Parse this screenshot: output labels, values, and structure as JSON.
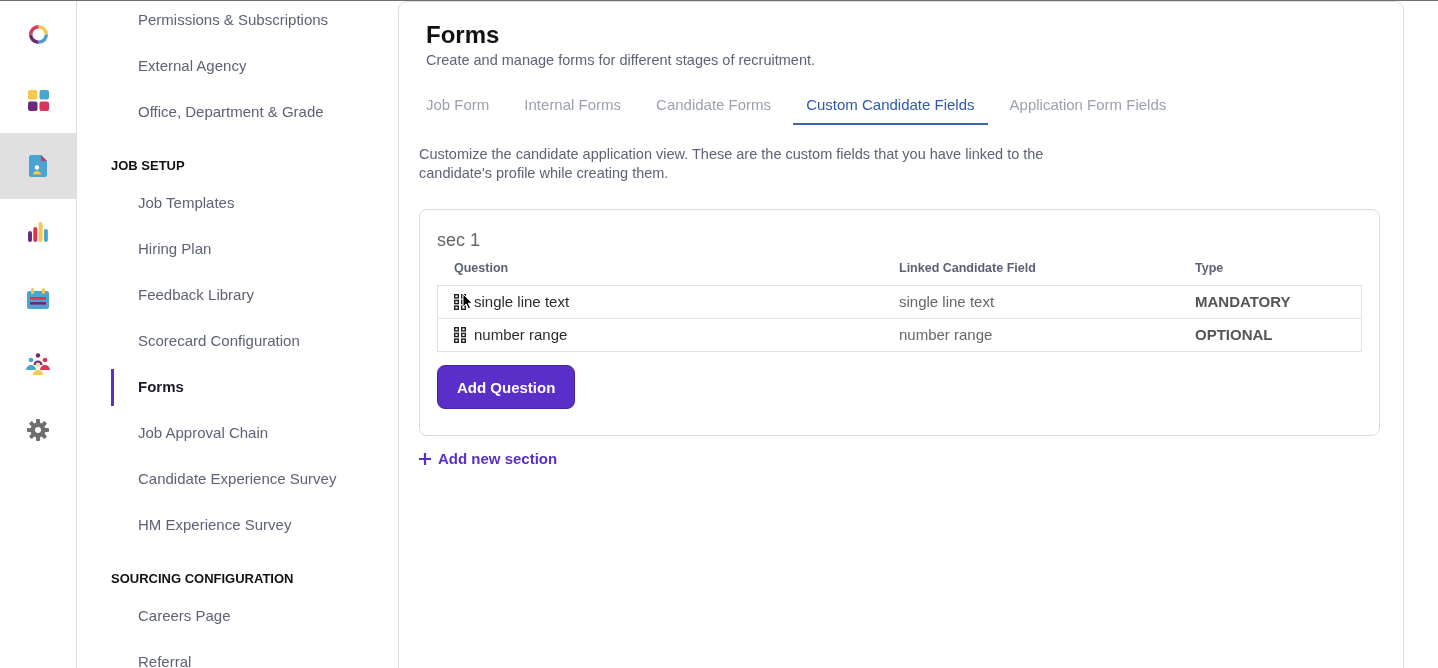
{
  "rail": {
    "items": [
      {
        "selected": false
      },
      {
        "selected": true
      },
      {
        "selected": false
      },
      {
        "selected": false
      },
      {
        "selected": false
      },
      {
        "selected": false
      }
    ]
  },
  "sidebar": {
    "sections": [
      {
        "items": [
          {
            "label": "Permissions & Subscriptions",
            "selected": false
          },
          {
            "label": "External Agency",
            "selected": false
          },
          {
            "label": "Office, Department & Grade",
            "selected": false
          }
        ]
      },
      {
        "heading": "JOB SETUP",
        "items": [
          {
            "label": "Job Templates",
            "selected": false
          },
          {
            "label": "Hiring Plan",
            "selected": false
          },
          {
            "label": "Feedback Library",
            "selected": false
          },
          {
            "label": "Scorecard Configuration",
            "selected": false
          },
          {
            "label": "Forms",
            "selected": true
          },
          {
            "label": "Job Approval Chain",
            "selected": false
          },
          {
            "label": "Candidate Experience Survey",
            "selected": false
          },
          {
            "label": "HM Experience Survey",
            "selected": false
          }
        ]
      },
      {
        "heading": "SOURCING CONFIGURATION",
        "items": [
          {
            "label": "Careers Page",
            "selected": false
          },
          {
            "label": "Referral",
            "selected": false
          }
        ]
      }
    ]
  },
  "page": {
    "title": "Forms",
    "subtitle": "Create and manage forms for different stages of recruitment.",
    "tabs": [
      {
        "label": "Job Form",
        "selected": false
      },
      {
        "label": "Internal Forms",
        "selected": false
      },
      {
        "label": "Candidate Forms",
        "selected": false
      },
      {
        "label": "Custom Candidate Fields",
        "selected": true
      },
      {
        "label": "Application Form Fields",
        "selected": false
      }
    ],
    "description": "Customize the candidate application view. These are the custom fields that you have linked to the candidate's profile while creating them.",
    "sections": [
      {
        "title": "sec 1",
        "columns": [
          "Question",
          "Linked Candidate Field",
          "Type"
        ],
        "rows": [
          {
            "question": "single line text",
            "linked_field": "single line text",
            "type": "MANDATORY"
          },
          {
            "question": "number range",
            "linked_field": "number range",
            "type": "OPTIONAL"
          }
        ],
        "add_button": "Add Question"
      }
    ],
    "add_section": "Add new section"
  }
}
